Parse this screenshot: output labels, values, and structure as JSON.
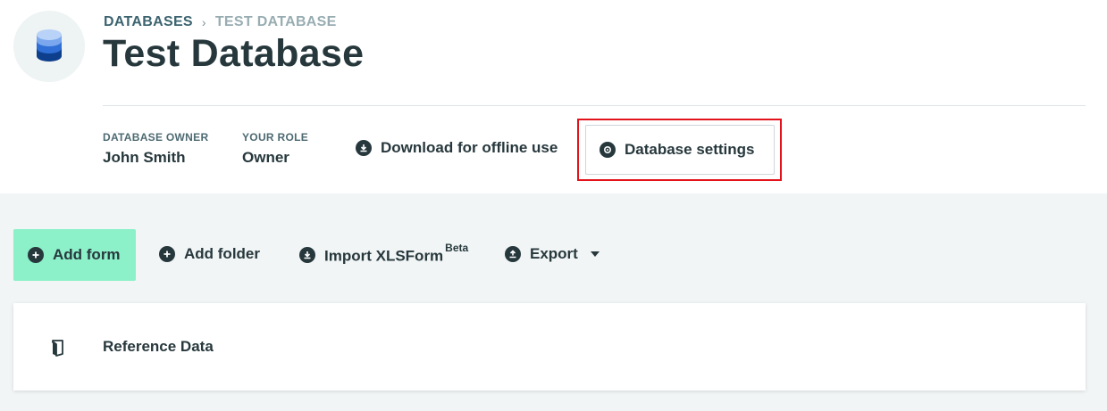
{
  "breadcrumb": {
    "root": "DATABASES",
    "separator": "›",
    "current": "TEST DATABASE"
  },
  "page_title": "Test Database",
  "meta": {
    "owner_label": "DATABASE OWNER",
    "owner_value": "John Smith",
    "role_label": "YOUR ROLE",
    "role_value": "Owner"
  },
  "header_actions": {
    "download_label": "Download for offline use",
    "settings_label": "Database settings"
  },
  "toolbar": {
    "add_form_label": "Add form",
    "add_folder_label": "Add folder",
    "import_label": "Import XLSForm",
    "import_badge": "Beta",
    "export_label": "Export"
  },
  "list": {
    "items": [
      {
        "label": "Reference Data",
        "icon": "folder-icon"
      }
    ]
  },
  "colors": {
    "primary_text": "#27383d",
    "accent_green": "#8cf0c9",
    "highlight_red": "#e3121b",
    "main_bg": "#f1f5f5"
  }
}
